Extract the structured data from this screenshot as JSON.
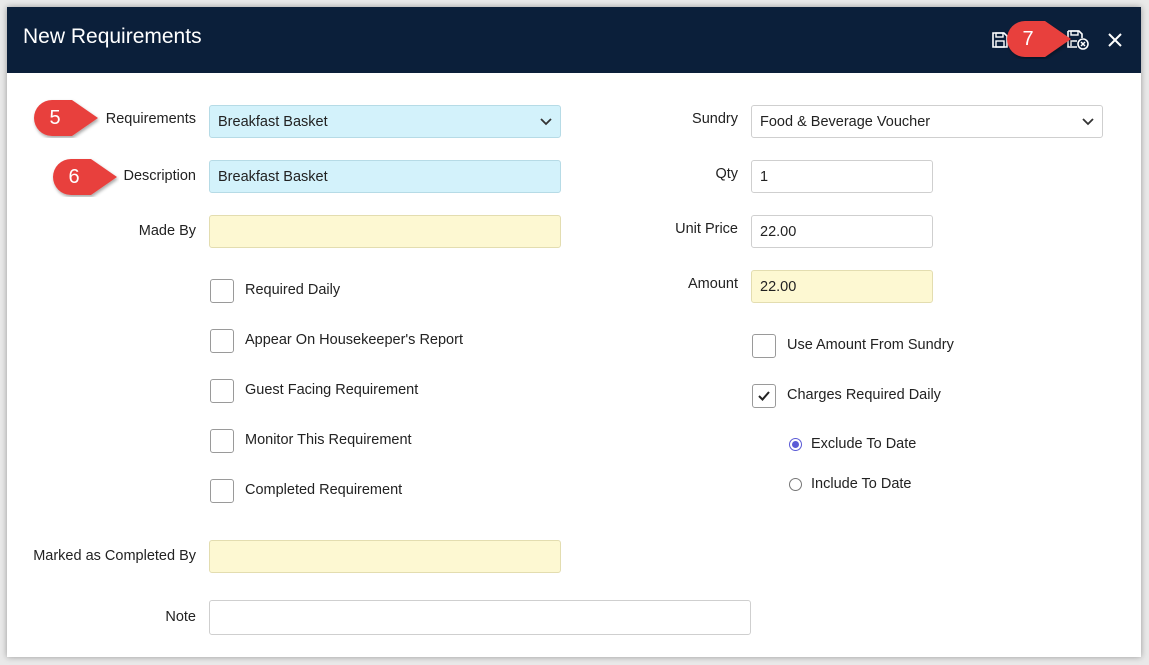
{
  "window": {
    "title": "New Requirements"
  },
  "callouts": [
    "5",
    "6",
    "7"
  ],
  "colors": {
    "titlebar": "#0b1f3a",
    "callout": "#e8413e",
    "radio_accent": "#5b5bd6",
    "field_blue": "#d3f2fb",
    "field_yellow": "#fdf8d2"
  },
  "form": {
    "requirements": {
      "label": "Requirements",
      "value": "Breakfast Basket"
    },
    "description": {
      "label": "Description",
      "value": "Breakfast Basket"
    },
    "made_by": {
      "label": "Made By",
      "value": ""
    },
    "checkboxes": [
      {
        "label": "Required Daily",
        "checked": false
      },
      {
        "label": "Appear On Housekeeper's Report",
        "checked": false
      },
      {
        "label": "Guest Facing Requirement",
        "checked": false
      },
      {
        "label": "Monitor This Requirement",
        "checked": false
      },
      {
        "label": "Completed Requirement",
        "checked": false
      }
    ],
    "marked_completed_by": {
      "label": "Marked as Completed By",
      "value": ""
    },
    "note": {
      "label": "Note",
      "value": ""
    },
    "sundry": {
      "label": "Sundry",
      "value": "Food & Beverage Voucher"
    },
    "qty": {
      "label": "Qty",
      "value": "1"
    },
    "unit_price": {
      "label": "Unit Price",
      "value": "22.00"
    },
    "amount": {
      "label": "Amount",
      "value": "22.00"
    },
    "use_amount_from_sundry": {
      "label": "Use Amount From Sundry",
      "checked": false
    },
    "charges_required_daily": {
      "label": "Charges Required Daily",
      "checked": true
    },
    "date_options": [
      {
        "label": "Exclude To Date",
        "selected": true
      },
      {
        "label": "Include To Date",
        "selected": false
      }
    ]
  }
}
